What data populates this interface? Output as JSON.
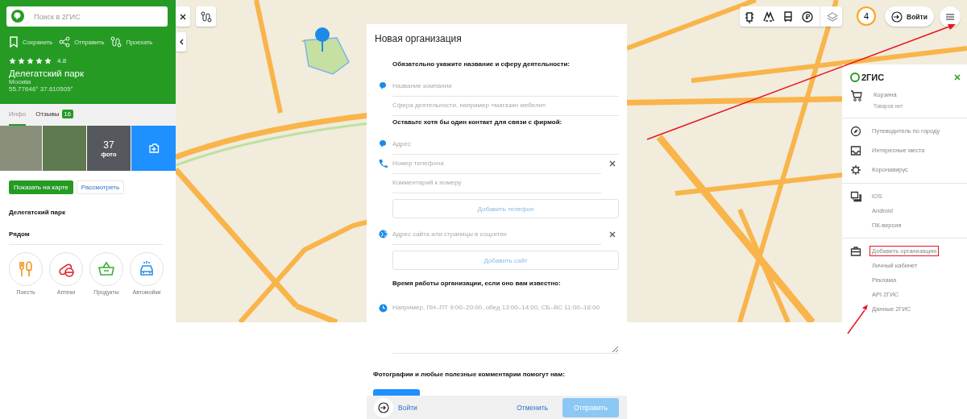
{
  "sidebar": {
    "search": {
      "placeholder": "Поиск в 2ГИС"
    },
    "actions": [
      {
        "kind": "bookmark",
        "label": "Сохранить"
      },
      {
        "kind": "share",
        "label": "Отправить"
      },
      {
        "kind": "route",
        "label": "Проехать"
      }
    ],
    "stars": 5,
    "rating": "4.8",
    "title": "Делегатский парк",
    "city": "Москва",
    "coords": "55.77646° 37.610505°",
    "tabs": [
      {
        "label": "Инфо",
        "selected": true
      },
      {
        "label": "Отзывы",
        "badge": "16",
        "selected": false
      }
    ],
    "photos": {
      "count": "37",
      "caption": "фото"
    },
    "buttons": [
      {
        "kind": "primary",
        "label": "Показать на карте"
      },
      {
        "kind": "secondary",
        "label": "Рассмотреть"
      }
    ],
    "place_name": "Делегатский парк",
    "nearby_title": "Рядом",
    "nearby": [
      {
        "kind": "food",
        "label": "Поесть"
      },
      {
        "kind": "pharmacy",
        "label": "Аптеки"
      },
      {
        "kind": "basket",
        "label": "Продукты"
      },
      {
        "kind": "carwash",
        "label": "Автомойки"
      }
    ]
  },
  "map_toolbar": {
    "badge": "4",
    "login": "Войти"
  },
  "dialog": {
    "title": "Новая организация",
    "items": [
      {
        "kind": "heading",
        "text": "Обязательно укажите название и сферу деятельности:"
      },
      {
        "kind": "name",
        "placeholder": "Название компании",
        "clearable": false
      },
      {
        "kind": "activity",
        "placeholder": "Сфера деятельности, например «магазин мебели»",
        "clearable": false
      },
      {
        "kind": "heading",
        "text": "Оставьте хотя бы один контакт для связи с фирмой:"
      },
      {
        "kind": "address",
        "placeholder": "Адрес",
        "clearable": false
      },
      {
        "kind": "phone",
        "placeholder": "Номер телефона",
        "clearable": true
      },
      {
        "kind": "comment",
        "placeholder": "Комментарий к номеру",
        "clearable": false
      },
      {
        "kind": "button",
        "text": "Добавить телефон"
      },
      {
        "kind": "website",
        "placeholder": "Адрес сайта или страницы в соцсетях",
        "clearable": true
      },
      {
        "kind": "button",
        "text": "Добавить сайт"
      },
      {
        "kind": "heading",
        "text": "Время работы организации, если оно вам известно:"
      },
      {
        "kind": "hours",
        "placeholder": "Например, ПН–ПТ 9:00–20:00, обед 13:00–14:00, СБ–ВС 11:00–18:00"
      },
      {
        "kind": "note",
        "text": "Фотографии и любые полезные комментарии помогут нам:"
      }
    ],
    "login": "Войти",
    "cancel": "Отменить",
    "submit": {
      "label": "Отправить",
      "disabled": true
    }
  },
  "menu": {
    "logo": "2ГИС",
    "groups": [
      [
        {
          "kind": "cart",
          "lines": [
            {
              "text": "Корзина",
              "sub": false,
              "highlighted": false
            },
            {
              "text": "Товаров нет",
              "sub": true,
              "highlighted": false
            }
          ]
        }
      ],
      [
        {
          "kind": "guide",
          "lines": [
            {
              "text": "Путеводитель по городу",
              "sub": false,
              "highlighted": false
            }
          ]
        },
        {
          "kind": "places",
          "lines": [
            {
              "text": "Интересные места",
              "sub": false,
              "highlighted": false
            }
          ]
        },
        {
          "kind": "covid",
          "lines": [
            {
              "text": "Коронавирус",
              "sub": false,
              "highlighted": false
            }
          ]
        }
      ],
      [
        {
          "kind": "apps",
          "lines": [
            {
              "text": "iOS",
              "sub": false,
              "highlighted": false
            },
            {
              "text": "Android",
              "sub": false,
              "highlighted": false
            },
            {
              "text": "ПК-версия",
              "sub": false,
              "highlighted": false
            }
          ]
        }
      ],
      [
        {
          "kind": "business",
          "lines": [
            {
              "text": "Добавить организацию",
              "sub": false,
              "highlighted": true
            },
            {
              "text": "Личный кабинет",
              "sub": false,
              "highlighted": false
            },
            {
              "text": "Реклама",
              "sub": false,
              "highlighted": false
            },
            {
              "text": "API 2ГИС",
              "sub": false,
              "highlighted": false
            },
            {
              "text": "Данные 2ГИС",
              "sub": false,
              "highlighted": false
            }
          ]
        }
      ]
    ]
  }
}
